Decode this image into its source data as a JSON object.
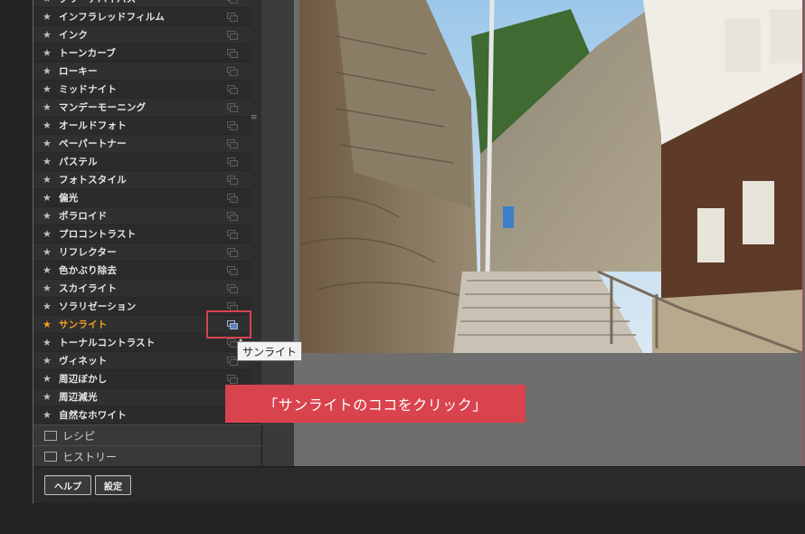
{
  "filters": [
    {
      "label": "ブリーチバイパス",
      "active": false
    },
    {
      "label": "インフラレッドフィルム",
      "active": false
    },
    {
      "label": "インク",
      "active": false
    },
    {
      "label": "トーンカーブ",
      "active": false
    },
    {
      "label": "ローキー",
      "active": false
    },
    {
      "label": "ミッドナイト",
      "active": false
    },
    {
      "label": "マンデーモーニング",
      "active": false
    },
    {
      "label": "オールドフォト",
      "active": false
    },
    {
      "label": "ペーパートナー",
      "active": false
    },
    {
      "label": "パステル",
      "active": false
    },
    {
      "label": "フォトスタイル",
      "active": false
    },
    {
      "label": "偏光",
      "active": false
    },
    {
      "label": "ポラロイド",
      "active": false
    },
    {
      "label": "プロコントラスト",
      "active": false
    },
    {
      "label": "リフレクター",
      "active": false
    },
    {
      "label": "色かぶり除去",
      "active": false
    },
    {
      "label": "スカイライト",
      "active": false
    },
    {
      "label": "ソラリゼーション",
      "active": false
    },
    {
      "label": "サンライト",
      "active": true
    },
    {
      "label": "トーナルコントラスト",
      "active": false
    },
    {
      "label": "ヴィネット",
      "active": false
    },
    {
      "label": "周辺ぼかし",
      "active": false
    },
    {
      "label": "周辺減光",
      "active": false
    },
    {
      "label": "自然なホワイト",
      "active": false
    }
  ],
  "sections": {
    "recipe": "レシピ",
    "history": "ヒストリー"
  },
  "buttons": {
    "help": "ヘルプ",
    "settings": "設定"
  },
  "tooltip": "サンライト",
  "callout": "「サンライトのココをクリック」",
  "colors": {
    "active": "#f4a11c",
    "highlight": "#d9434e"
  },
  "icons": {
    "star": "star-icon",
    "copy": "copy-icon",
    "recipe": "recipe-icon",
    "history": "history-icon"
  }
}
